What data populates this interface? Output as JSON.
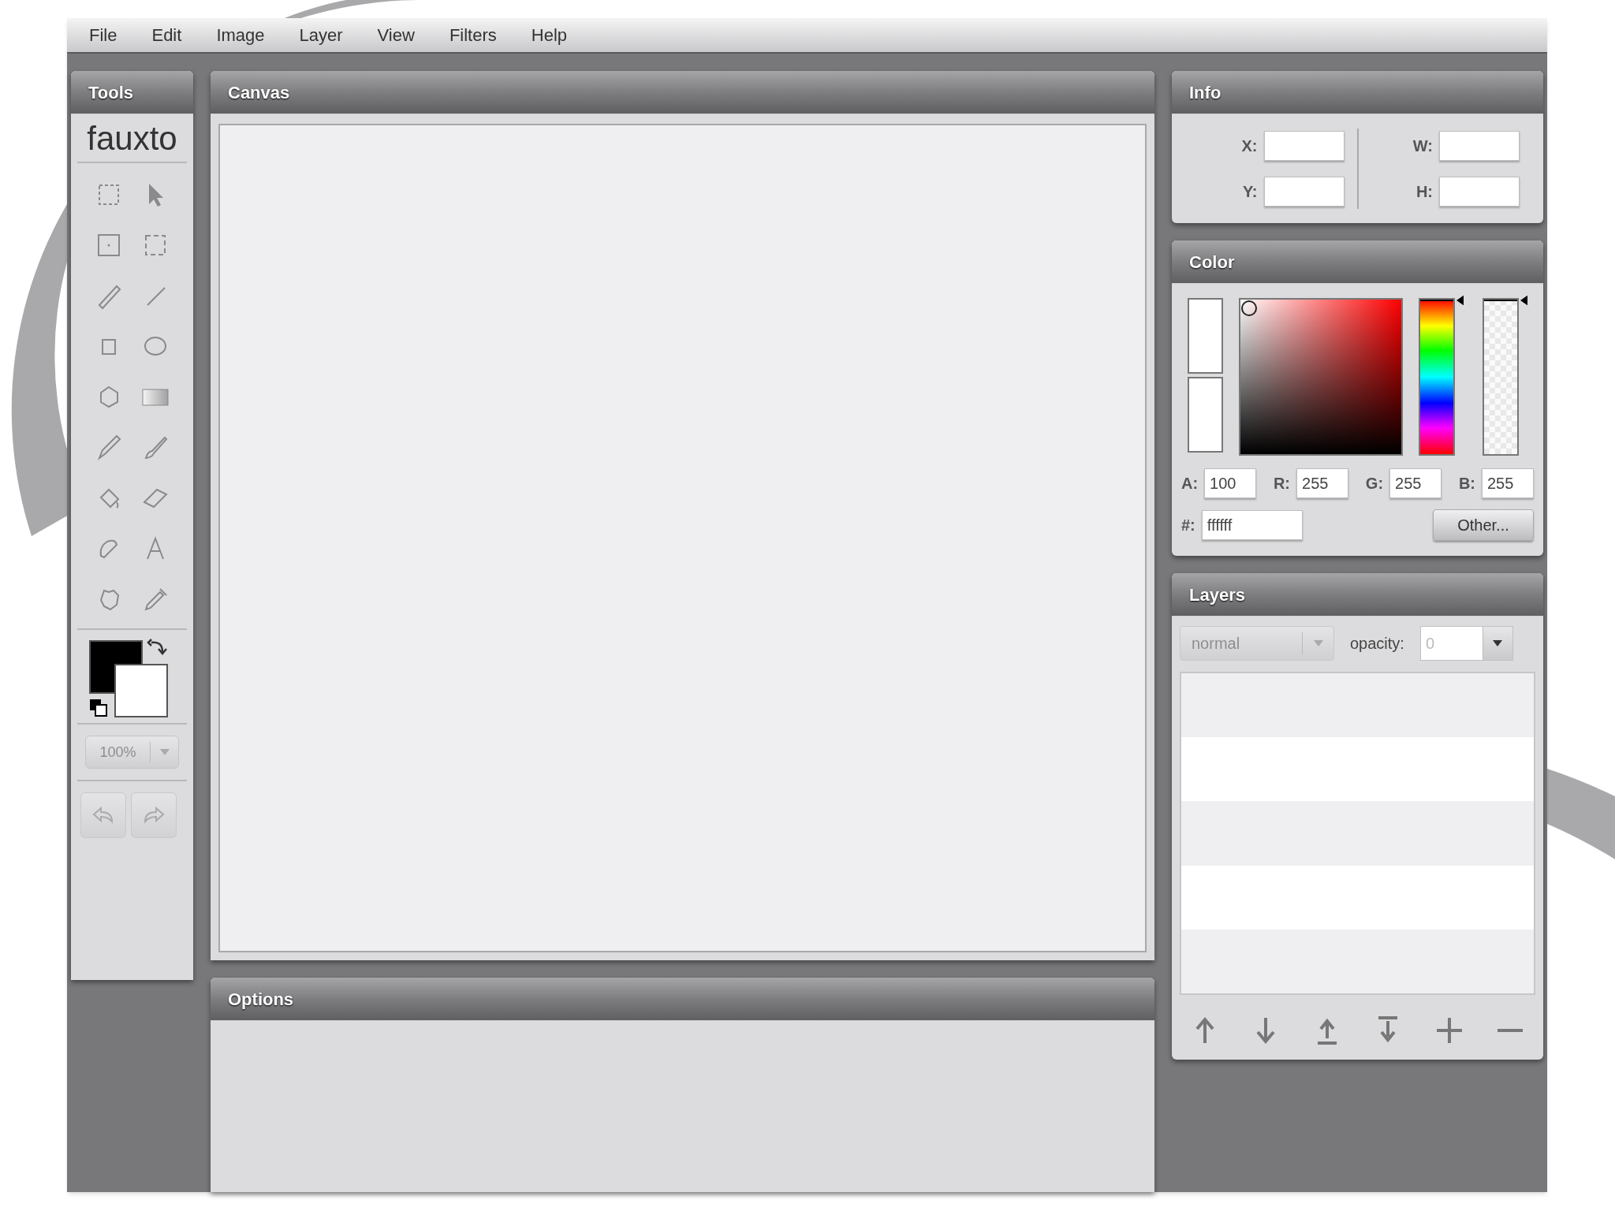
{
  "menu": [
    "File",
    "Edit",
    "Image",
    "Layer",
    "View",
    "Filters",
    "Help"
  ],
  "tools": {
    "title": "Tools",
    "logo": "fauxto",
    "zoom": {
      "value": "100%",
      "disabled": true
    }
  },
  "canvas": {
    "title": "Canvas"
  },
  "options": {
    "title": "Options"
  },
  "info": {
    "title": "Info",
    "fields": [
      {
        "label": "X:"
      },
      {
        "label": "W:"
      },
      {
        "label": "Y:"
      },
      {
        "label": "H:"
      }
    ]
  },
  "color": {
    "title": "Color",
    "sliders": [
      {
        "kind": "hue",
        "level": 0
      },
      {
        "kind": "alpha",
        "level": 0
      }
    ],
    "fields": [
      {
        "label": "A:",
        "value": "100"
      },
      {
        "label": "R:",
        "value": "255"
      },
      {
        "label": "G:",
        "value": "255"
      },
      {
        "label": "B:",
        "value": "255"
      }
    ],
    "hex": {
      "label": "#:",
      "value": "ffffff"
    },
    "button": "Other..."
  },
  "layers": {
    "title": "Layers",
    "blend": {
      "value": "normal",
      "disabled": true
    },
    "opacity_label": "opacity:",
    "opacity": {
      "value": "0"
    }
  }
}
